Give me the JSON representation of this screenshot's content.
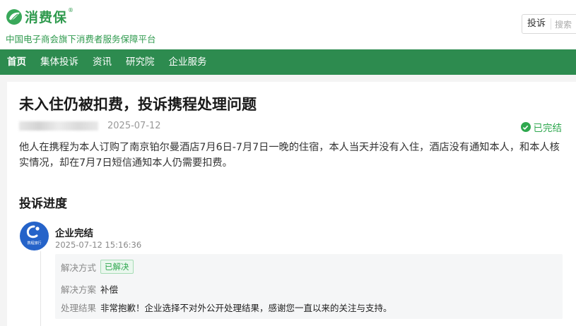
{
  "header": {
    "logo_text": "消费保",
    "logo_reg": "®",
    "tagline": "中国电子商会旗下消费者服务保障平台",
    "complain_button": "投诉",
    "search_placeholder": "搜索"
  },
  "nav": {
    "items": [
      "首页",
      "集体投诉",
      "资讯",
      "研究院",
      "企业服务"
    ]
  },
  "complaint": {
    "title": "未入住仍被扣费，投诉携程处理问题",
    "date": "2025-07-12",
    "status": "已完结",
    "description": "他人在携程为本人订购了南京铂尔曼酒店7月6日-7月7日一晚的住宿，本人当天并没有入住，酒店没有通知本人，和本人核实情况，却在7月7日短信通知本人仍需要扣费。"
  },
  "progress": {
    "section_title": "投诉进度",
    "step_title": "企业完结",
    "step_time": "2025-07-12 15:16:36",
    "avatar_text": "携程旅行",
    "method_label": "解决方式",
    "method_value": "已解决",
    "plan_label": "解决方案",
    "plan_value": "补偿",
    "result_label": "处理结果",
    "result_value": "非常抱歉！企业选择不对外公开处理结果，感谢您一直以来的关注与支持。"
  },
  "colors": {
    "brand_green": "#2f9a4e",
    "nav_bg": "#2d8b4f",
    "status_green": "#2fa84f",
    "avatar_blue": "#2563c9"
  },
  "icons": [
    "logo-leaf-icon",
    "check-circle-icon",
    "ctrip-logo-icon"
  ]
}
